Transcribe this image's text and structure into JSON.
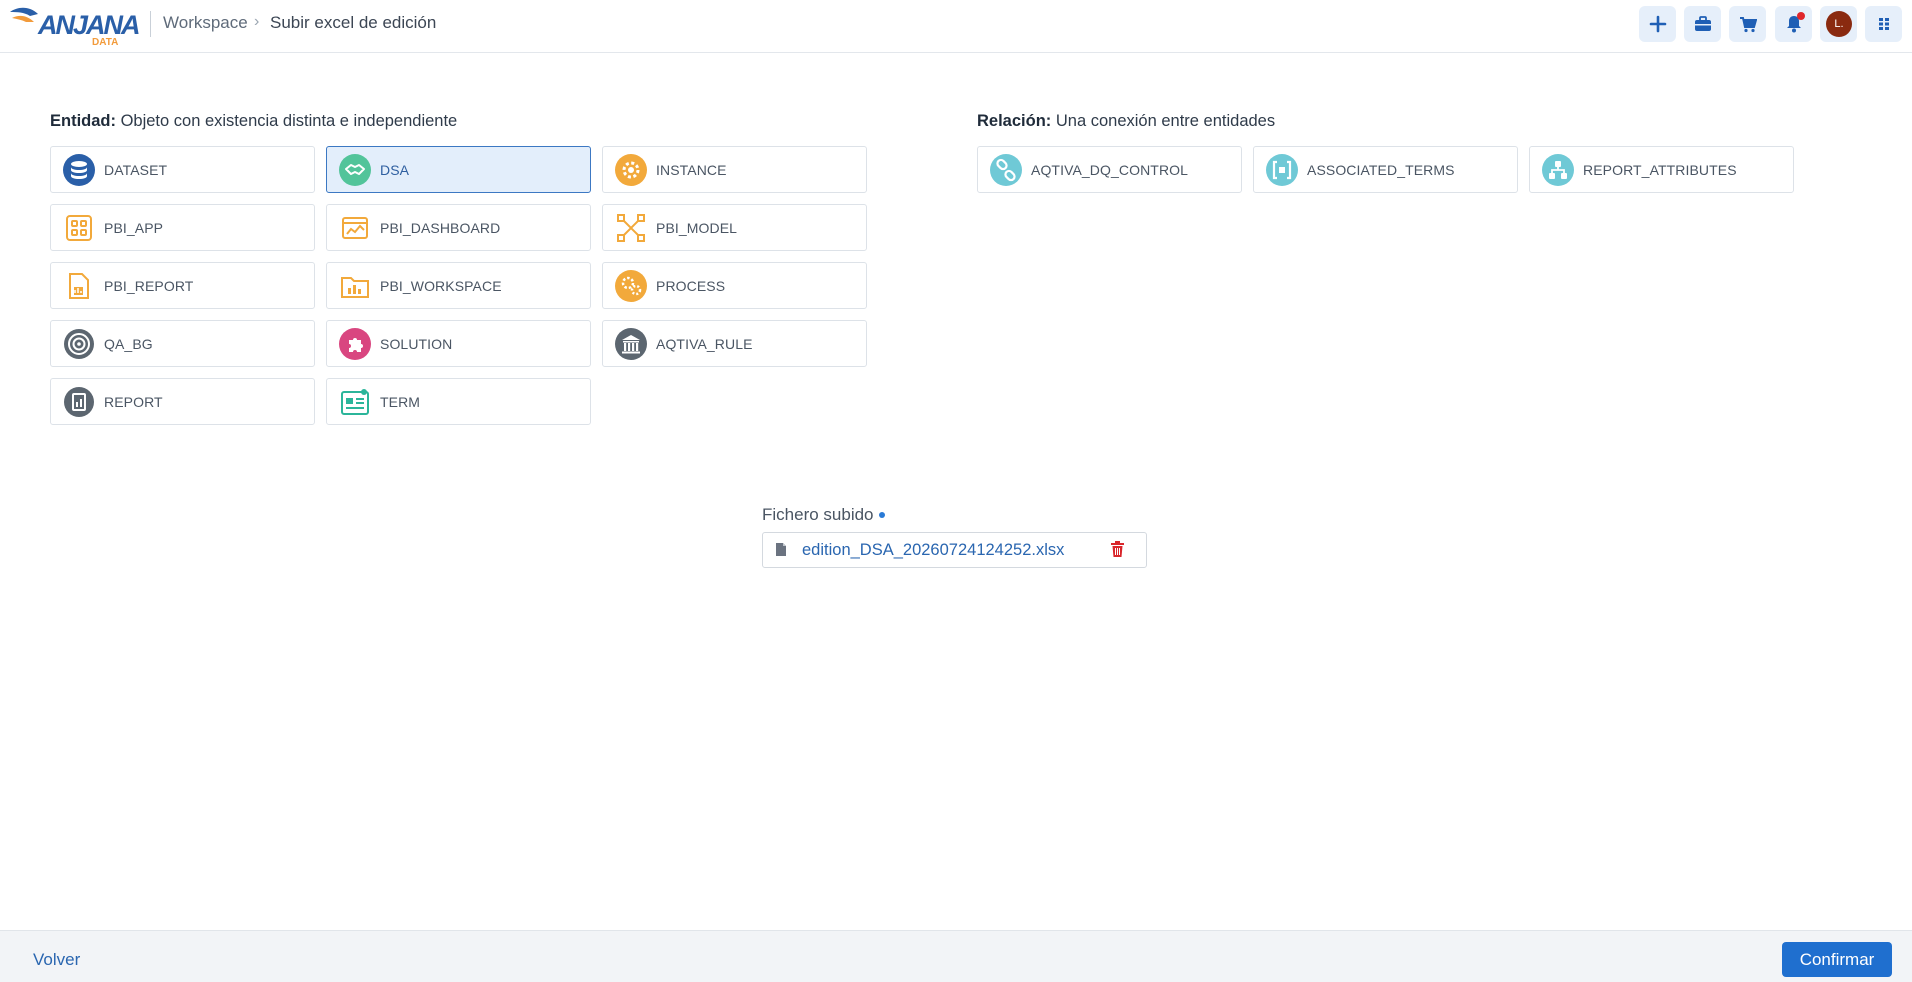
{
  "header": {
    "logo_text": "ANJANA",
    "logo_sub": "DATA",
    "breadcrumb": [
      "Workspace",
      "Subir excel de edición"
    ],
    "avatar_initial": "L.",
    "buttons": [
      "plus-icon",
      "briefcase-icon",
      "cart-icon",
      "bell-icon",
      "grid-icon"
    ]
  },
  "entities": {
    "title_bold": "Entidad:",
    "title_rest": " Objeto con existencia distinta e independiente",
    "items": [
      {
        "label": "DATASET",
        "icon": "database-icon",
        "selected": false
      },
      {
        "label": "DSA",
        "icon": "handshake-icon",
        "selected": true
      },
      {
        "label": "INSTANCE",
        "icon": "gear-icon",
        "selected": false
      },
      {
        "label": "PBI_APP",
        "icon": "app-grid-icon",
        "selected": false
      },
      {
        "label": "PBI_DASHBOARD",
        "icon": "dashboard-icon",
        "selected": false
      },
      {
        "label": "PBI_MODEL",
        "icon": "model-icon",
        "selected": false
      },
      {
        "label": "PBI_REPORT",
        "icon": "report-doc-icon",
        "selected": false
      },
      {
        "label": "PBI_WORKSPACE",
        "icon": "folder-chart-icon",
        "selected": false
      },
      {
        "label": "PROCESS",
        "icon": "gears-icon",
        "selected": false
      },
      {
        "label": "QA_BG",
        "icon": "target-icon",
        "selected": false
      },
      {
        "label": "SOLUTION",
        "icon": "puzzle-icon",
        "selected": false
      },
      {
        "label": "AQTIVA_RULE",
        "icon": "bank-icon",
        "selected": false
      },
      {
        "label": "REPORT",
        "icon": "report-icon",
        "selected": false
      },
      {
        "label": "TERM",
        "icon": "term-icon",
        "selected": false
      }
    ]
  },
  "relations": {
    "title_bold": "Relación:",
    "title_rest": " Una conexión entre entidades",
    "items": [
      {
        "label": "AQTIVA_DQ_CONTROL",
        "icon": "link-icon"
      },
      {
        "label": "ASSOCIATED_TERMS",
        "icon": "brackets-icon"
      },
      {
        "label": "REPORT_ATTRIBUTES",
        "icon": "hierarchy-icon"
      }
    ]
  },
  "upload": {
    "title": "Fichero subido",
    "file_name": "edition_DSA_20260724124252.xlsx"
  },
  "footer": {
    "back_label": "Volver",
    "confirm_label": "Confirmar"
  },
  "colors": {
    "primary": "#1f6fcf",
    "selected_bg": "#e3eefb",
    "delete": "#d9262b",
    "icon_orange": "#f2a93b",
    "icon_teal": "#6fc9d6"
  }
}
